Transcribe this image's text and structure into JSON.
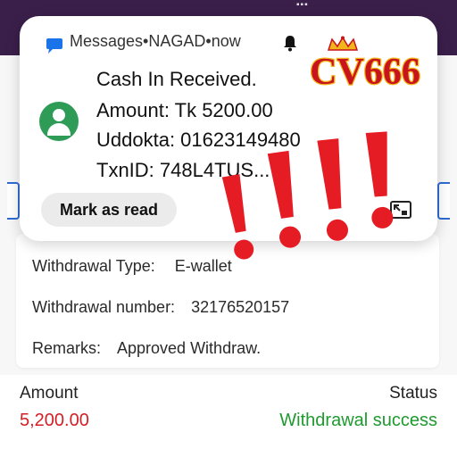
{
  "notification": {
    "app_name": "Messages",
    "sender": "NAGAD",
    "time": "now",
    "separator": "•",
    "line1": "Cash In Received.",
    "line2": "Amount: Tk 5200.00",
    "line3": "Uddokta: 01623149480",
    "line4": "TxnID: 748L4TUS...",
    "mark_as_read": "Mark as read"
  },
  "logo": {
    "text": "CV666"
  },
  "details": {
    "withdrawal_type_label": "Withdrawal Type:",
    "withdrawal_type_value": "E-wallet",
    "withdrawal_number_label": "Withdrawal number:",
    "withdrawal_number_value": "32176520157",
    "remarks_label": "Remarks:",
    "remarks_value": "Approved Withdraw."
  },
  "summary": {
    "amount_label": "Amount",
    "amount_value": "5,200.00",
    "status_label": "Status",
    "status_value": "Withdrawal success"
  },
  "colors": {
    "amount": "#d21f26",
    "success": "#1f9a2f",
    "avatar": "#2e9b57",
    "logo_gold": "#f2b61c",
    "logo_red": "#c8141c"
  },
  "icons": [
    "messages-app-icon",
    "bell-icon",
    "avatar-icon",
    "expand-icon",
    "crown-icon",
    "exclamation-icon"
  ]
}
